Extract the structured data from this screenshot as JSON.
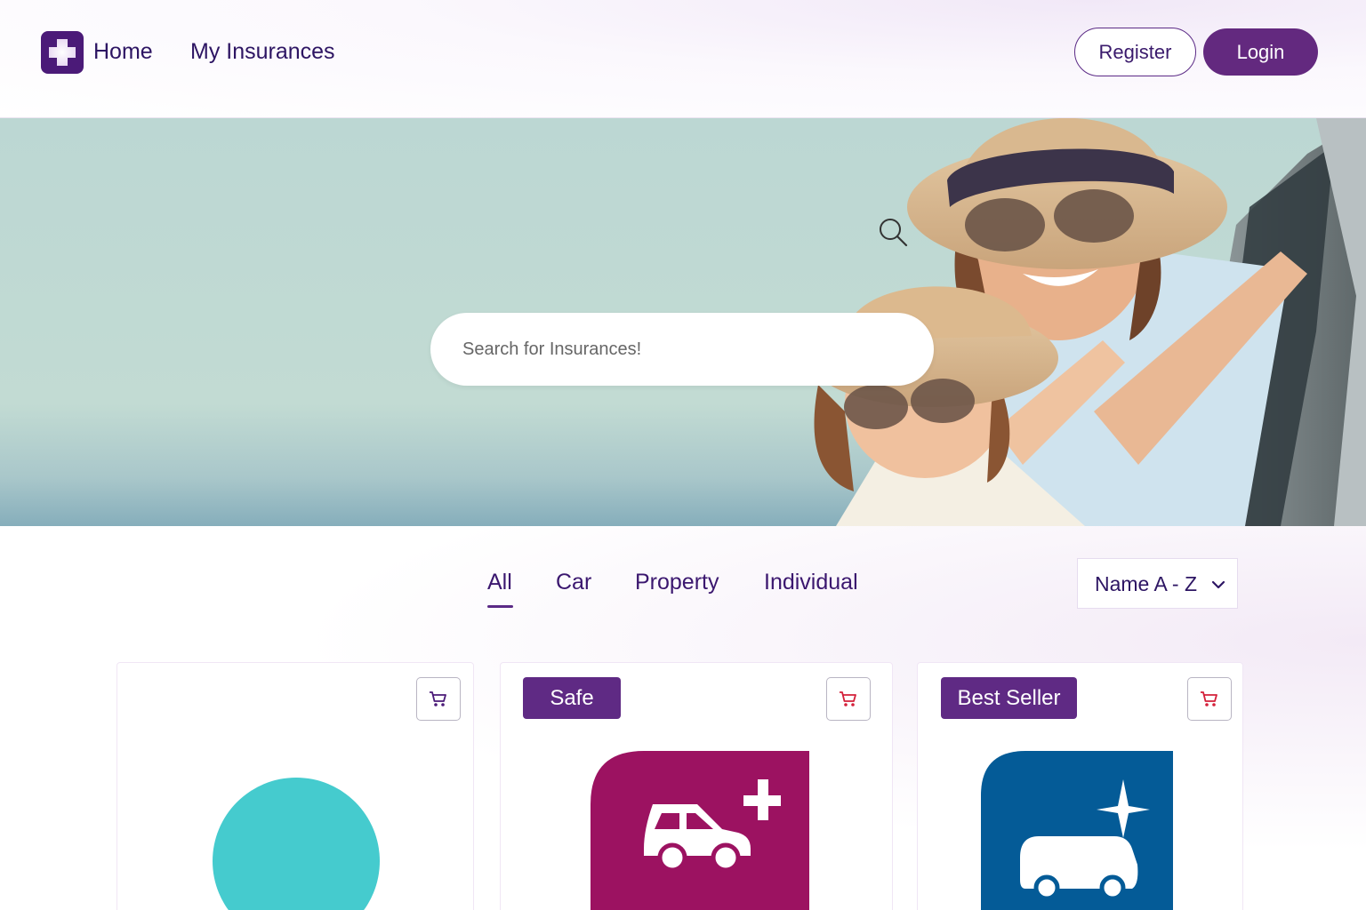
{
  "header": {
    "nav": {
      "home": "Home",
      "my_insurances": "My Insurances"
    },
    "actions": {
      "register": "Register",
      "login": "Login"
    }
  },
  "hero": {
    "search": {
      "placeholder": "Search for Insurances!"
    }
  },
  "filters": {
    "tabs": [
      {
        "label": "All",
        "active": true
      },
      {
        "label": "Car",
        "active": false
      },
      {
        "label": "Property",
        "active": false
      },
      {
        "label": "Individual",
        "active": false
      }
    ],
    "sort": {
      "selected": "Name A - Z"
    }
  },
  "products": [
    {
      "badge": "",
      "icon": "teal-circle-icon"
    },
    {
      "badge": "Safe",
      "icon": "car-plus-icon"
    },
    {
      "badge": "Best Seller",
      "icon": "suv-sparkle-icon"
    }
  ],
  "colors": {
    "brand": "#63297f",
    "brand_dark": "#2d1563",
    "hero_sky": "#c2dbd3",
    "teal": "#45cbce",
    "magenta": "#9c1261",
    "blue": "#045b97",
    "cart_red": "#d4203a"
  }
}
